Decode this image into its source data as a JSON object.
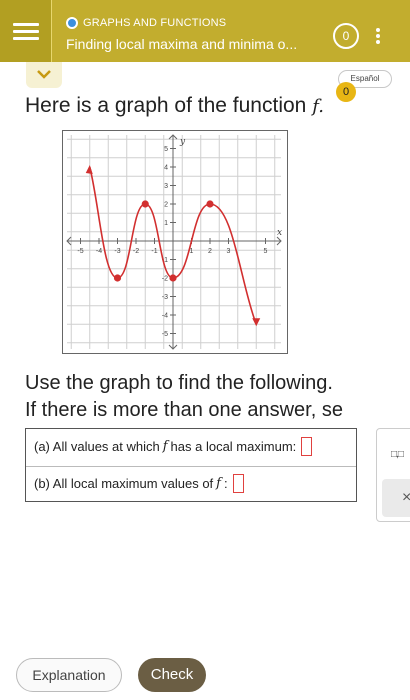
{
  "header": {
    "topic": "GRAPHS AND FUNCTIONS",
    "title": "Finding local maxima and minima o...",
    "score": "0",
    "menu_icon": "hamburger-icon",
    "more_icon": "more-vertical-icon"
  },
  "language_toggle": "Español",
  "progress_badge": "0",
  "intro": {
    "text": "Here is a graph of the function",
    "func": "f."
  },
  "graph": {
    "y_axis_label": "y",
    "x_axis_label": "x",
    "x_ticks": [
      "-5",
      "-4",
      "-3",
      "-2",
      "-1",
      "1",
      "2",
      "3",
      "5"
    ],
    "y_ticks": [
      "5",
      "4",
      "3",
      "2",
      "1",
      "-1",
      "-2",
      "-3",
      "-4",
      "-5"
    ],
    "curve_color": "#d22f2f",
    "points": [
      [
        -4.5,
        4
      ],
      [
        -3,
        -2
      ],
      [
        -1.5,
        2
      ],
      [
        0,
        -2
      ],
      [
        2,
        2
      ],
      [
        4.5,
        -4.5
      ]
    ],
    "marked_points": [
      [
        -3,
        -2
      ],
      [
        -1.5,
        2
      ],
      [
        0,
        -2
      ],
      [
        2,
        2
      ]
    ]
  },
  "instructions": {
    "line1": "Use the graph to find the following.",
    "line2": "If there is more than one answer, se"
  },
  "questions": {
    "a_prefix": "(a) All values at which",
    "a_func": "f",
    "a_suffix": "has a local maximum:",
    "b_prefix": "(b) All local maximum values of",
    "b_func": "f",
    "b_suffix": ":"
  },
  "side_panel": {
    "interval_symbol": "□,□",
    "clear_symbol": "×"
  },
  "buttons": {
    "explanation": "Explanation",
    "check": "Check"
  }
}
